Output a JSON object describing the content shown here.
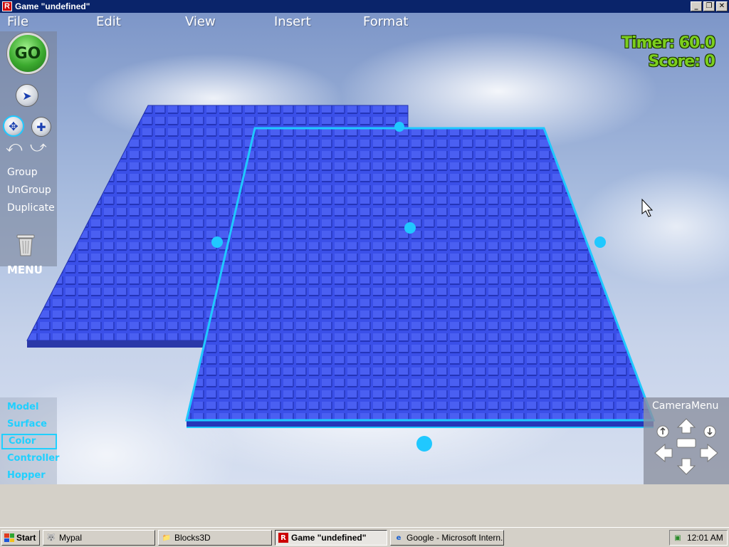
{
  "window": {
    "title": "Game \"undefined\"",
    "app_icon": "R"
  },
  "menubar": {
    "items": [
      "File",
      "Edit",
      "View",
      "Insert",
      "Format"
    ]
  },
  "toolbar": {
    "go_label": "GO",
    "group": "Group",
    "ungroup": "UnGroup",
    "duplicate": "Duplicate",
    "menu": "MENU"
  },
  "hud": {
    "timer": "Timer: 60.0",
    "score": "Score: 0"
  },
  "categories": {
    "items": [
      "Model",
      "Surface",
      "Color",
      "Controller",
      "Hopper"
    ],
    "selected": "Color"
  },
  "camera_menu": {
    "title": "CameraMenu"
  },
  "taskbar": {
    "start": "Start",
    "buttons": [
      {
        "label": "Mypal",
        "icon": "mypal-icon"
      },
      {
        "label": "Blocks3D",
        "icon": "folder-icon"
      },
      {
        "label": "Game \"undefined\"",
        "icon": "roblox-icon"
      },
      {
        "label": "Google - Microsoft Intern...",
        "icon": "ie-icon"
      }
    ],
    "time": "12:01 AM"
  },
  "colors": {
    "brick_blue": "#3a4fe8",
    "selection_cyan": "#20c8ff",
    "hud_green": "#7ccf1d"
  }
}
